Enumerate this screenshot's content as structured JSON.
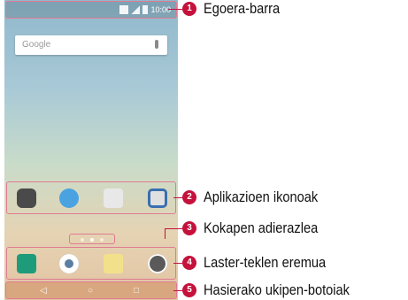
{
  "callouts": [
    {
      "number": "1",
      "label": "Egoera-barra"
    },
    {
      "number": "2",
      "label": "Aplikazioen ikonoak"
    },
    {
      "number": "3",
      "label": "Kokapen adierazlea"
    },
    {
      "number": "4",
      "label": "Laster-teklen eremua"
    },
    {
      "number": "5",
      "label": "Hasierako ukipen-botoiak"
    }
  ],
  "phone": {
    "status_time": "10:00",
    "search_placeholder": "Google",
    "colors": {
      "highlight": "#e07a93",
      "callout_badge": "#c4123c"
    },
    "icons": {
      "status": [
        "wifi-icon",
        "signal-icon",
        "battery-icon"
      ],
      "apps": [
        "folder-app-icon",
        "browser-app-icon",
        "play-store-app-icon",
        "camera-app-icon"
      ],
      "quick_keys": [
        "phone-icon",
        "contacts-icon",
        "messages-icon",
        "apps-icon"
      ],
      "home_buttons": [
        "back-icon",
        "home-icon",
        "recents-icon"
      ]
    }
  }
}
